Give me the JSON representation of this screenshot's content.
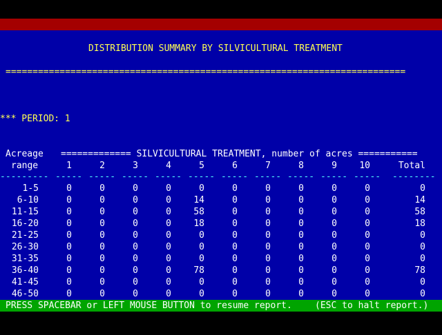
{
  "report": {
    "title": "DISTRIBUTION SUMMARY BY SILVICULTURAL TREATMENT",
    "separator": "==========================================================================",
    "period_label": "*** PERIOD: 1",
    "header_acreage": "Acreage",
    "header_range": "range",
    "header_treatment": "============= SILVICULTURAL TREATMENT, number of acres ===========",
    "columns": [
      "1",
      "2",
      "3",
      "4",
      "5",
      "6",
      "7",
      "8",
      "9",
      "10",
      "Total"
    ],
    "dashes_range": "---------",
    "dashes_col": "-----",
    "dashes_total": "--------",
    "rows": [
      {
        "range": "1-5",
        "values": [
          "0",
          "0",
          "0",
          "0",
          "0",
          "0",
          "0",
          "0",
          "0",
          "0",
          "0"
        ]
      },
      {
        "range": "6-10",
        "values": [
          "0",
          "0",
          "0",
          "0",
          "14",
          "0",
          "0",
          "0",
          "0",
          "0",
          "14"
        ]
      },
      {
        "range": "11-15",
        "values": [
          "0",
          "0",
          "0",
          "0",
          "58",
          "0",
          "0",
          "0",
          "0",
          "0",
          "58"
        ]
      },
      {
        "range": "16-20",
        "values": [
          "0",
          "0",
          "0",
          "0",
          "18",
          "0",
          "0",
          "0",
          "0",
          "0",
          "18"
        ]
      },
      {
        "range": "21-25",
        "values": [
          "0",
          "0",
          "0",
          "0",
          "0",
          "0",
          "0",
          "0",
          "0",
          "0",
          "0"
        ]
      },
      {
        "range": "26-30",
        "values": [
          "0",
          "0",
          "0",
          "0",
          "0",
          "0",
          "0",
          "0",
          "0",
          "0",
          "0"
        ]
      },
      {
        "range": "31-35",
        "values": [
          "0",
          "0",
          "0",
          "0",
          "0",
          "0",
          "0",
          "0",
          "0",
          "0",
          "0"
        ]
      },
      {
        "range": "36-40",
        "values": [
          "0",
          "0",
          "0",
          "0",
          "78",
          "0",
          "0",
          "0",
          "0",
          "0",
          "78"
        ]
      },
      {
        "range": "41-45",
        "values": [
          "0",
          "0",
          "0",
          "0",
          "0",
          "0",
          "0",
          "0",
          "0",
          "0",
          "0"
        ]
      },
      {
        "range": "46-50",
        "values": [
          "0",
          "0",
          "0",
          "0",
          "0",
          "0",
          "0",
          "0",
          "0",
          "0",
          "0"
        ]
      }
    ]
  },
  "status_bar": {
    "prompt": "PRESS SPACEBAR or LEFT MOUSE BUTTON to resume report.",
    "escape": "(ESC to halt report.)"
  },
  "colors": {
    "background": "#0000a8",
    "title": "#ffff54",
    "text": "#ffffff",
    "dashes": "#54ffff",
    "top_bar": "#a40000",
    "status_bar": "#00a400"
  }
}
